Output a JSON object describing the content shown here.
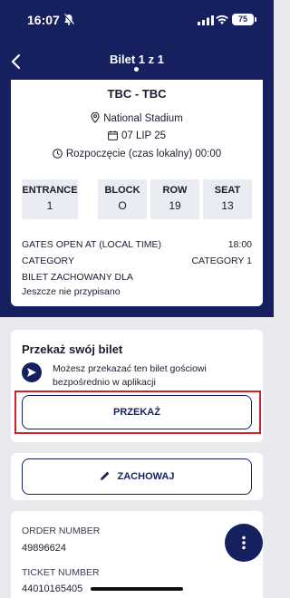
{
  "status_bar": {
    "time": "16:07",
    "battery": "75"
  },
  "nav": {
    "title": "Bilet 1 z 1"
  },
  "ticket": {
    "match": "TBC - TBC",
    "venue": "National Stadium",
    "date": "07 LIP 25",
    "kickoff": "Rozpoczęcie (czas lokalny)  00:00",
    "seat_info": [
      {
        "label": "ENTRANCE",
        "value": "1"
      },
      {
        "label": "BLOCK",
        "value": "O"
      },
      {
        "label": "ROW",
        "value": "19"
      },
      {
        "label": "SEAT",
        "value": "13"
      }
    ],
    "gates_label": "GATES OPEN AT (LOCAL TIME)",
    "gates_value": "18:00",
    "category_label": "CATEGORY",
    "category_value": "CATEGORY 1",
    "saved_for_label": "BILET ZACHOWANY DLA",
    "saved_for_value": "Jeszcze nie przypisano"
  },
  "transfer": {
    "title": "Przekaż swój bilet",
    "description": "Możesz przekazać ten bilet gościowi bezpośrednio w aplikacji",
    "button": "PRZEKAŻ"
  },
  "save": {
    "button": "ZACHOWAJ"
  },
  "order": {
    "order_number_label": "ORDER NUMBER",
    "order_number": "49896624",
    "ticket_number_label": "TICKET NUMBER",
    "ticket_number": "44010165405"
  },
  "colors": {
    "navy": "#16205f",
    "highlight": "#d0202a",
    "background": "#e9eaee"
  }
}
